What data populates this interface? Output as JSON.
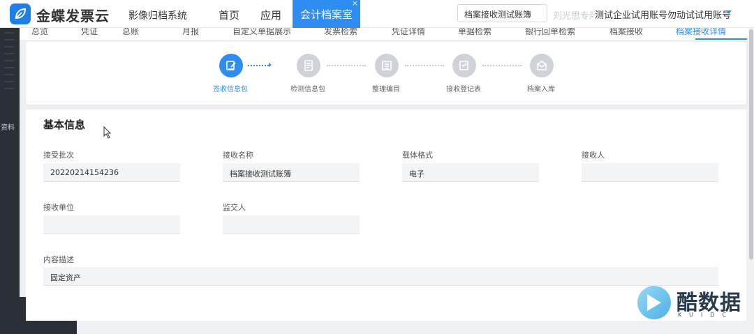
{
  "header": {
    "brand": "金蝶发票云",
    "system_name": "影像归档系统",
    "nav": [
      {
        "label": "首页"
      },
      {
        "label": "应用"
      },
      {
        "label": "会计档案室",
        "close": "×"
      }
    ],
    "account_select": "档案接收测试账簿",
    "faded_user": "刘光思专用",
    "company": "测试企业试用账号勿动试试用账号",
    "colors": {
      "primary": "#2f8cf0",
      "sidebar": "#2b2f36"
    }
  },
  "sidebar": {
    "partial_label": "资料",
    "toggle_icon": "indent-icon"
  },
  "subtabs": [
    {
      "label": "总览"
    },
    {
      "label": "凭证"
    },
    {
      "label": "总账"
    },
    {
      "label": "月报"
    },
    {
      "label": "自定义单据展示"
    },
    {
      "label": "发票检索"
    },
    {
      "label": "凭证详情"
    },
    {
      "label": "单据检索"
    },
    {
      "label": "银行回单检索"
    },
    {
      "label": "档案接收"
    },
    {
      "label": "档案接收详情",
      "active": true
    }
  ],
  "steps": [
    {
      "label": "签收信息包",
      "icon": "edit-doc-icon",
      "active": true
    },
    {
      "label": "检测信息包",
      "icon": "check-doc-icon",
      "active": false
    },
    {
      "label": "整理编目",
      "icon": "list-doc-icon",
      "active": false
    },
    {
      "label": "接收登记表",
      "icon": "register-doc-icon",
      "active": false
    },
    {
      "label": "档案入库",
      "icon": "archive-box-icon",
      "active": false
    }
  ],
  "basic_info": {
    "title": "基本信息",
    "fields": [
      {
        "label": "接受批次",
        "value": "20220214154236"
      },
      {
        "label": "接收名称",
        "value": "档案接收测试账簿"
      },
      {
        "label": "载体格式",
        "value": "电子"
      },
      {
        "label": "接收人",
        "value": ""
      },
      {
        "label": "接收单位",
        "value": ""
      },
      {
        "label": "监交人",
        "value": ""
      },
      {
        "label": "内容描述",
        "value": "固定资产"
      }
    ]
  },
  "watermark": {
    "text": "酷数据",
    "sub": "KUIDC"
  }
}
